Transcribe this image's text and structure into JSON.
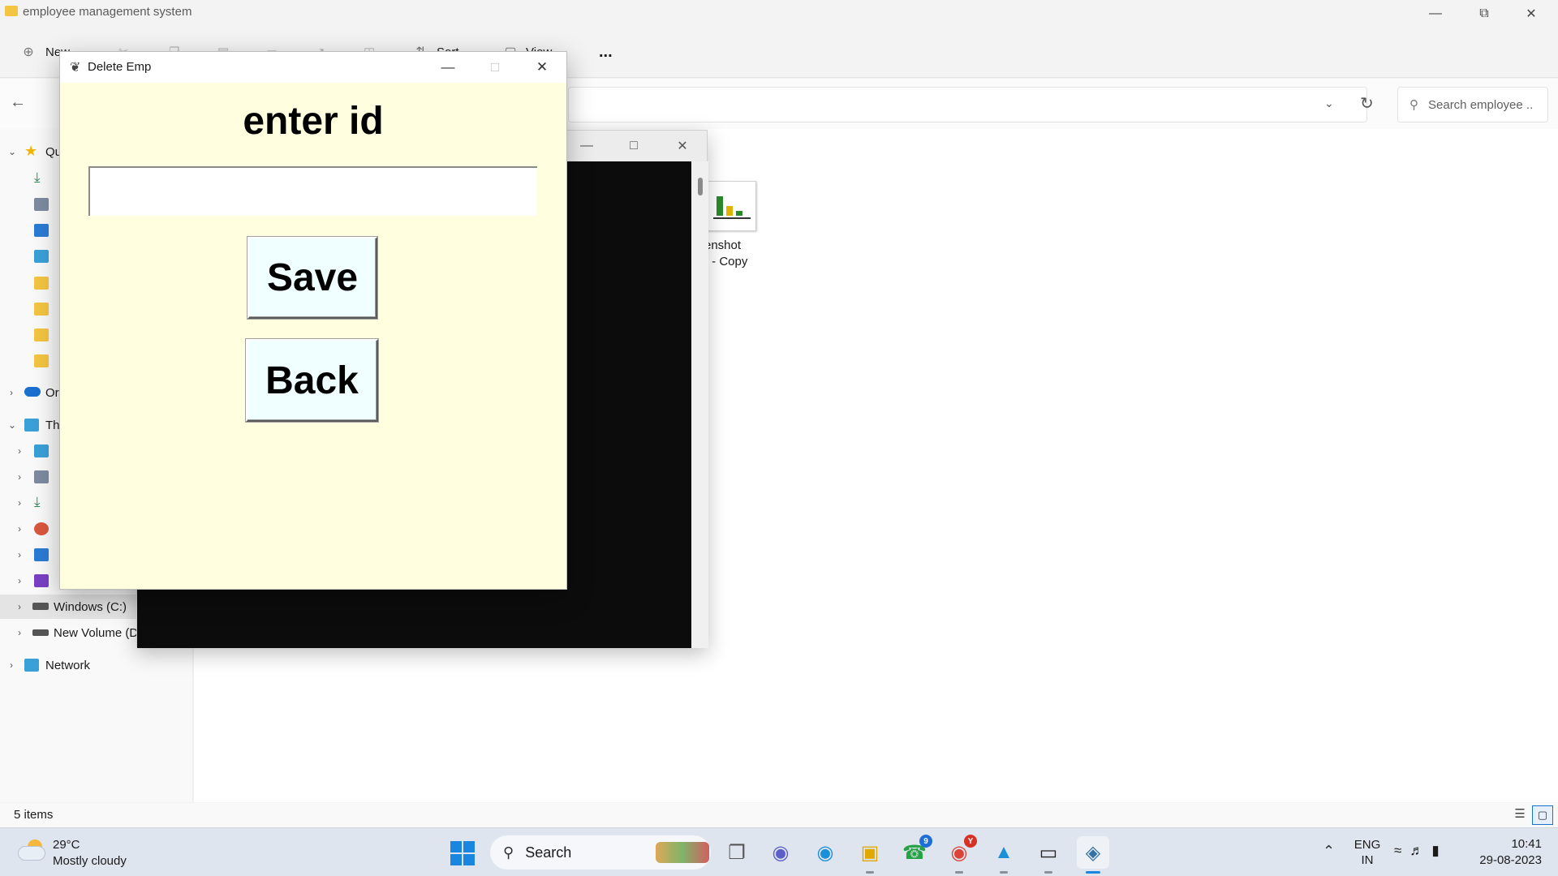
{
  "explorer": {
    "title": "employee management system",
    "toolbar": {
      "new_label": "New",
      "sort_label": "Sort",
      "view_label": "View",
      "more_label": "..."
    },
    "search": {
      "placeholder": "Search employee ..."
    },
    "nav": {
      "quick_access": "Qu",
      "onedrive": "Or",
      "this_pc": "Th",
      "windows_c": "Windows (C:)",
      "new_volume": "New Volume (D",
      "network": "Network"
    },
    "file": {
      "name_line1": "enshot",
      "name_line2": ") - Copy"
    },
    "status": {
      "items": "5 items"
    }
  },
  "dialog": {
    "title": "Delete Emp",
    "heading": "enter id",
    "id_value": "",
    "save_label": "Save",
    "back_label": "Back"
  },
  "taskbar": {
    "weather_temp": "29°C",
    "weather_desc": "Mostly cloudy",
    "search_label": "Search",
    "whatsapp_badge": "9",
    "chrome_badge": "Y",
    "lang_line1": "ENG",
    "lang_line2": "IN",
    "time": "10:41",
    "date": "29-08-2023"
  },
  "colors": {
    "dialog_bg": "#ffffe0",
    "button_bg": "#f0ffff",
    "accent": "#1a86e0"
  },
  "icons": [
    "folder-icon",
    "minimize-icon",
    "maximize-icon",
    "close-icon",
    "back-arrow-icon",
    "refresh-icon",
    "search-icon",
    "star-icon",
    "feather-icon",
    "weather-icon",
    "windows-start-icon",
    "whatsapp-icon",
    "chrome-icon",
    "edge-icon",
    "terminal-icon",
    "python-icon",
    "wifi-icon",
    "volume-icon",
    "battery-icon"
  ]
}
